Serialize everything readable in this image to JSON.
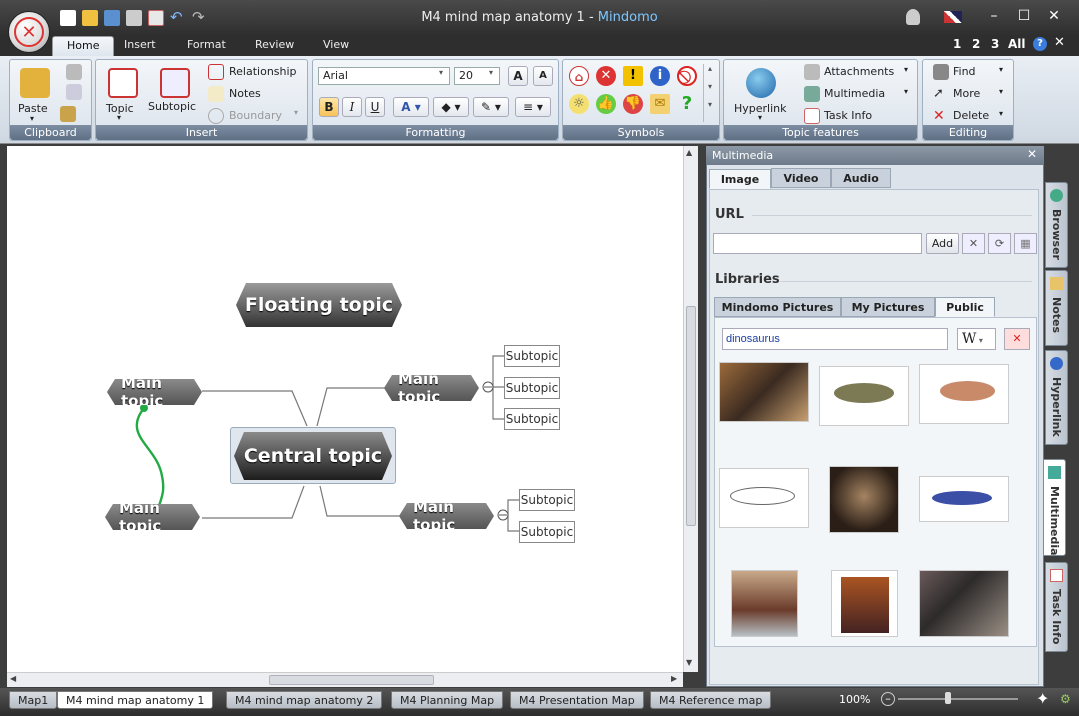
{
  "window": {
    "title_main": "M4 mind map anatomy 1",
    "title_sep": " - ",
    "title_brand": "Mindomo"
  },
  "ribbon_tabs": [
    "Home",
    "Insert",
    "Format",
    "Review",
    "View"
  ],
  "quick_nums": [
    "1",
    "2",
    "3",
    "All"
  ],
  "clipboard": {
    "paste": "Paste",
    "label": "Clipboard"
  },
  "insert_group": {
    "topic": "Topic",
    "subtopic": "Subtopic",
    "relationship": "Relationship",
    "notes": "Notes",
    "boundary": "Boundary",
    "label": "Insert"
  },
  "formatting": {
    "font": "Arial",
    "size": "20",
    "bold": "B",
    "italic": "I",
    "underline": "U",
    "label": "Formatting"
  },
  "symbols": {
    "label": "Symbols"
  },
  "topic_features": {
    "hyperlink": "Hyperlink",
    "attachments": "Attachments",
    "multimedia": "Multimedia",
    "task_info": "Task Info",
    "label": "Topic features"
  },
  "editing": {
    "find": "Find",
    "more": "More",
    "delete": "Delete",
    "label": "Editing"
  },
  "map": {
    "floating": "Floating topic",
    "central": "Central topic",
    "main_topics": [
      "Main topic",
      "Main topic",
      "Main topic",
      "Main topic"
    ],
    "subtopics": [
      "Subtopic",
      "Subtopic",
      "Subtopic",
      "Subtopic",
      "Subtopic"
    ]
  },
  "panel": {
    "title": "Multimedia",
    "tabs": [
      "Image",
      "Video",
      "Audio"
    ],
    "url_label": "URL",
    "url_value": "",
    "add_button": "Add",
    "libraries_label": "Libraries",
    "lib_tabs": [
      "Mindomo Pictures",
      "My Pictures",
      "Public"
    ],
    "search_value": "dinosaurus",
    "source": "W"
  },
  "side_tabs": [
    "Browser",
    "Notes",
    "Hyperlink",
    "Multimedia",
    "Task Info"
  ],
  "bottom_tabs": [
    "Map1",
    "M4 mind map anatomy 1",
    "M4 mind map anatomy 2",
    "M4 Planning Map",
    "M4 Presentation Map",
    "M4 Reference map"
  ],
  "zoom": "100%",
  "colors": {
    "relationship": "#22aa44",
    "titlebar": "#3a3a3a",
    "ribbon_label": "#6b7b90"
  }
}
